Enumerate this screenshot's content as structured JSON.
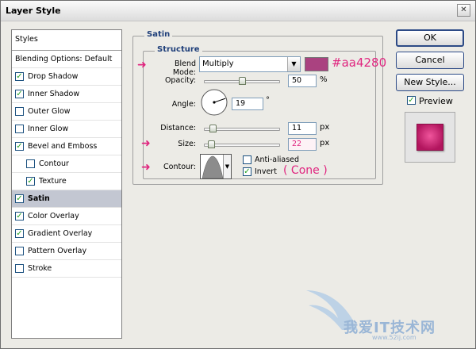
{
  "window": {
    "title": "Layer Style",
    "close_label": "✕"
  },
  "styles": {
    "header": "Styles",
    "items": [
      {
        "label": "Blending Options: Default",
        "checkbox": false,
        "checked": false,
        "indent": 0
      },
      {
        "label": "Drop Shadow",
        "checkbox": true,
        "checked": true,
        "indent": 0
      },
      {
        "label": "Inner Shadow",
        "checkbox": true,
        "checked": true,
        "indent": 0
      },
      {
        "label": "Outer Glow",
        "checkbox": true,
        "checked": false,
        "indent": 0
      },
      {
        "label": "Inner Glow",
        "checkbox": true,
        "checked": false,
        "indent": 0
      },
      {
        "label": "Bevel and Emboss",
        "checkbox": true,
        "checked": true,
        "indent": 0
      },
      {
        "label": "Contour",
        "checkbox": true,
        "checked": false,
        "indent": 1
      },
      {
        "label": "Texture",
        "checkbox": true,
        "checked": true,
        "indent": 1
      },
      {
        "label": "Satin",
        "checkbox": true,
        "checked": true,
        "indent": 0,
        "selected": true
      },
      {
        "label": "Color Overlay",
        "checkbox": true,
        "checked": true,
        "indent": 0
      },
      {
        "label": "Gradient Overlay",
        "checkbox": true,
        "checked": true,
        "indent": 0
      },
      {
        "label": "Pattern Overlay",
        "checkbox": true,
        "checked": false,
        "indent": 0
      },
      {
        "label": "Stroke",
        "checkbox": true,
        "checked": false,
        "indent": 0
      }
    ]
  },
  "satin": {
    "group_title": "Satin",
    "structure_title": "Structure",
    "blend_mode_label": "Blend Mode:",
    "blend_mode_value": "Multiply",
    "blend_color": "#aa4280",
    "color_annotation": "#aa4280",
    "opacity_label": "Opacity:",
    "opacity_value": "50",
    "opacity_unit": "%",
    "opacity_level": 0.5,
    "angle_label": "Angle:",
    "angle_value": "19",
    "angle_unit": "°",
    "distance_label": "Distance:",
    "distance_value": "11",
    "distance_unit": "px",
    "distance_level": 0.11,
    "size_label": "Size:",
    "size_value": "22",
    "size_unit": "px",
    "size_level": 0.09,
    "contour_label": "Contour:",
    "anti_aliased_label": "Anti-aliased",
    "anti_aliased_checked": false,
    "invert_label": "Invert",
    "invert_checked": true,
    "contour_annotation": "( Cone )"
  },
  "buttons": {
    "ok": "OK",
    "cancel": "Cancel",
    "new_style": "New Style...",
    "preview_label": "Preview",
    "preview_checked": true
  },
  "watermark": {
    "text": "我爱IT技术网",
    "url": "www.52ij.com"
  },
  "accent_color": "#e0257f"
}
